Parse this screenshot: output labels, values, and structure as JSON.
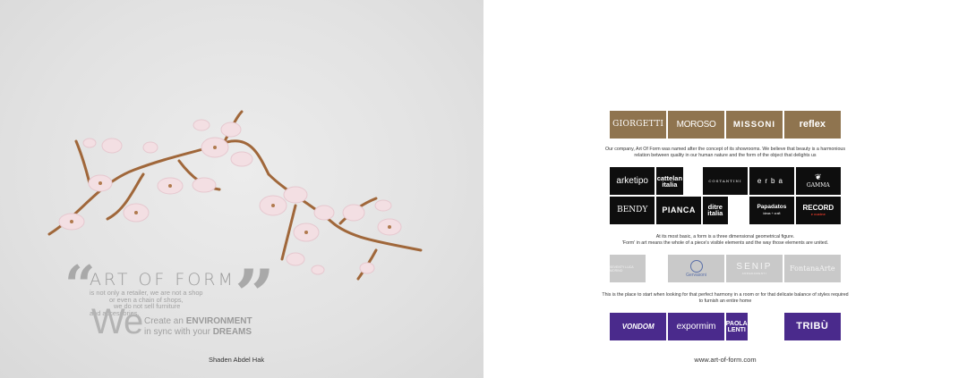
{
  "left_page": {
    "quote": {
      "brand": "ART OF FORM",
      "lines": [
        "is not only a retailer, we are not a shop",
        "or even a chain of shops,",
        "we do not sell furniture",
        "and accessories."
      ],
      "we": "We",
      "slogan_line1_prefix": "Create an ",
      "slogan_line1_emphasis": "ENVIRONMENT",
      "slogan_line2_prefix": "in sync with your ",
      "slogan_line2_emphasis": "DREAMS"
    },
    "author": "Shaden Abdel Hak"
  },
  "right_page": {
    "group1": [
      "GIORGETTI",
      "MOROSO",
      "MISSONI",
      "reflex"
    ],
    "paragraph1": [
      "Our company, Art Of Form was named after the concept of its showrooms. We believe that beauty is a harmonious",
      "relation between quality in our human nature and the form of the object that delights us"
    ],
    "group2_row1": [
      "arketipo",
      "cattelan italia",
      "COSTANTINI",
      "erba",
      "GAMMA"
    ],
    "group2_row2": [
      "BENDY",
      "PIANCA",
      "ditre italia",
      "Papadatos",
      "RECORD"
    ],
    "group2_subtexts": {
      "papadatos": "ideas + craft",
      "record": "e cucine"
    },
    "paragraph2": [
      "At its most basic, a form is a three dimensional geometrical figure.",
      "'Form' in art means the whole of a piece's visible elements and the way those elements are united."
    ],
    "group3": [
      "SEVENTY LUCA MORINO",
      "Gervasoni",
      "SENIP",
      "FontanaArte"
    ],
    "group3_subtext": "ARREDAMENTI",
    "paragraph3": [
      "This is the place to start when looking for that perfect harmony in a room or for that delicate balance of styles required",
      "to furnish an entire home"
    ],
    "group4": [
      "VONDOM",
      "expormim",
      "PAOLA LENTI",
      "TRIBÙ"
    ],
    "website": "www.art-of-form.com"
  },
  "colors": {
    "gold_tile": "#8f744f",
    "black_tile": "#0e0e0e",
    "grey_tile": "#c9c9c9",
    "purple_tile": "#4a2a8c",
    "left_background": "#e3e3e3"
  }
}
